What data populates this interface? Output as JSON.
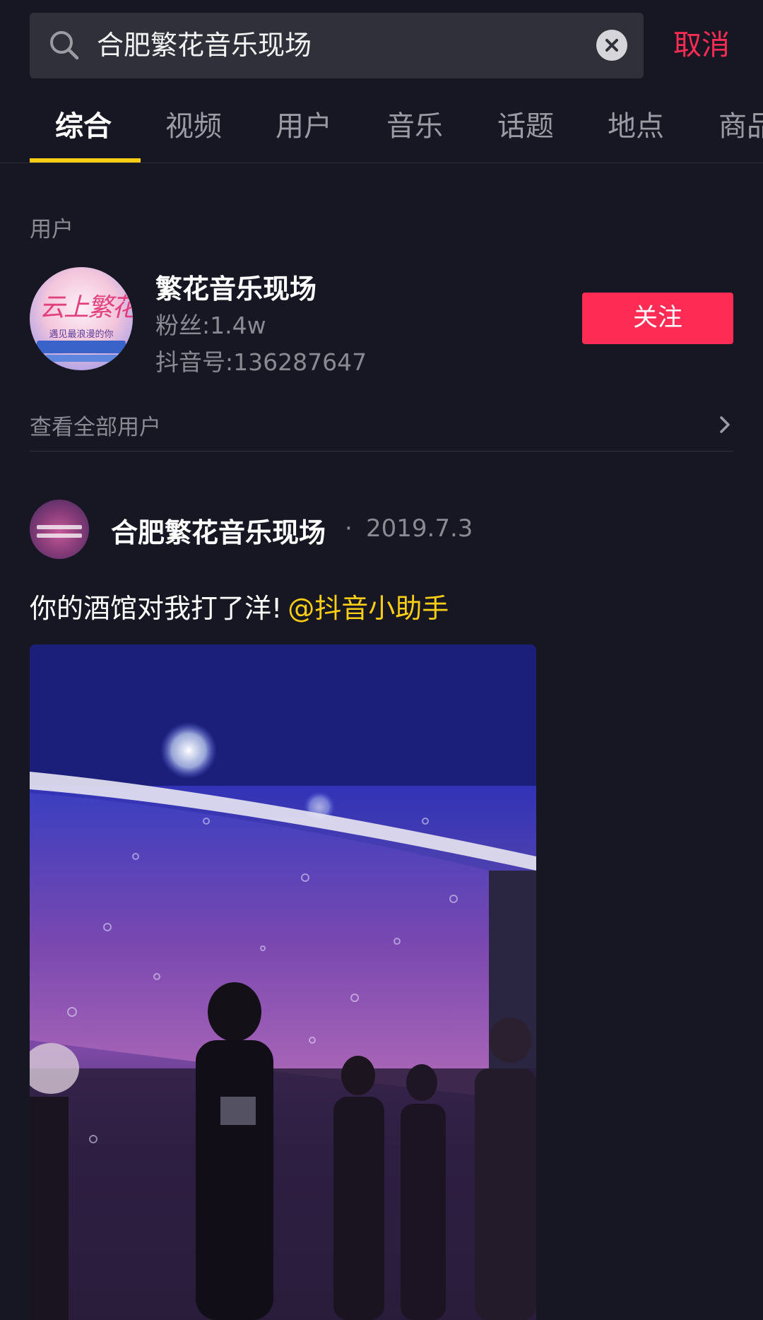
{
  "search": {
    "query": "合肥繁花音乐现场",
    "cancel_label": "取消"
  },
  "tabs": [
    {
      "label": "综合",
      "active": true
    },
    {
      "label": "视频",
      "active": false
    },
    {
      "label": "用户",
      "active": false
    },
    {
      "label": "音乐",
      "active": false
    },
    {
      "label": "话题",
      "active": false
    },
    {
      "label": "地点",
      "active": false
    },
    {
      "label": "商品",
      "active": false
    }
  ],
  "user_section": {
    "label": "用户",
    "user": {
      "name": "繁花音乐现场",
      "fans": "粉丝:1.4w",
      "douyin_id": "抖音号:136287647"
    },
    "follow_label": "关注",
    "view_all_label": "查看全部用户"
  },
  "post": {
    "author": "合肥繁花音乐现场",
    "separator": "·",
    "date": "2019.7.3",
    "caption": "你的酒馆对我打了洋!",
    "mention": "@抖音小助手"
  },
  "colors": {
    "background": "#161722",
    "accent_red": "#fe2c55",
    "tab_indicator": "#face15",
    "mention": "#face15",
    "secondary_text": "#8a8a93"
  },
  "icons": {
    "search": "search-icon",
    "clear": "clear-icon",
    "chevron": "chevron-right-icon"
  }
}
